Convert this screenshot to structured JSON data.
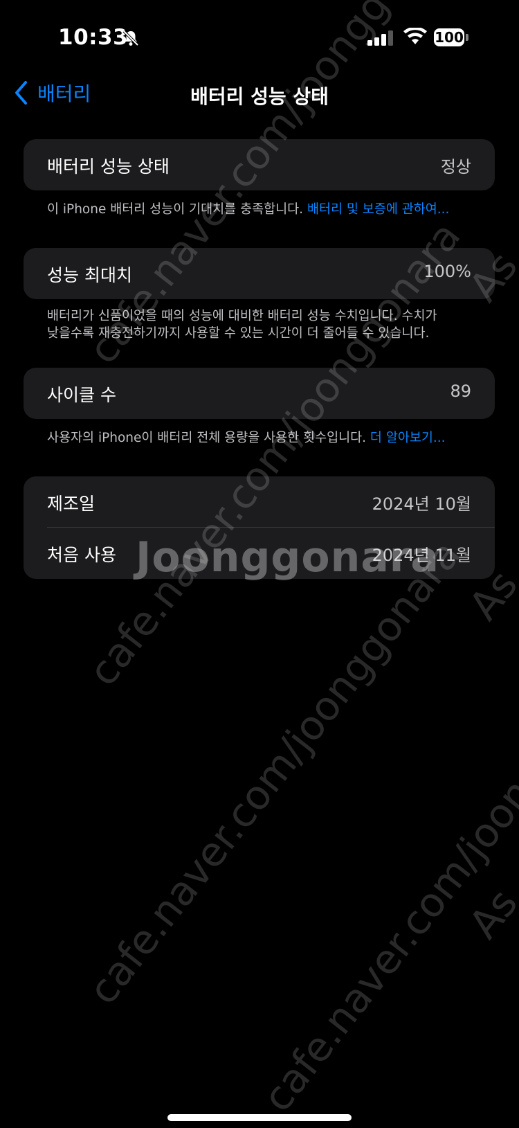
{
  "status_bar": {
    "time": "10:33",
    "battery_level": "100"
  },
  "nav": {
    "back_label": "배터리",
    "title": "배터리 성능 상태"
  },
  "health": {
    "label": "배터리 성능 상태",
    "value": "정상",
    "note_text": "이 iPhone 배터리 성능이 기대치를 충족합니다. ",
    "note_link": "배터리 및 보증에 관하여..."
  },
  "capacity": {
    "label": "성능 최대치",
    "value": "100%",
    "note_line1": "배터리가 신품이었을 때의 성능에 대비한 배터리 성능 수치입니다. 수치가",
    "note_line2": "낮을수록 재충전하기까지 사용할 수 있는 시간이 더 줄어들 수 있습니다."
  },
  "cycles": {
    "label": "사이클 수",
    "value": "89",
    "note_text": "사용자의 iPhone이 배터리 전체 용량을 사용한 횟수입니다. ",
    "note_link": "더 알아보기..."
  },
  "dates": {
    "manufactured_label": "제조일",
    "manufactured_value": "2024년 10월",
    "first_use_label": "처음 사용",
    "first_use_value": "2024년 11월"
  },
  "watermark": {
    "url": "cafe.naver.com/joonggonara",
    "brand": "Joonggonara",
    "edge": "As"
  }
}
